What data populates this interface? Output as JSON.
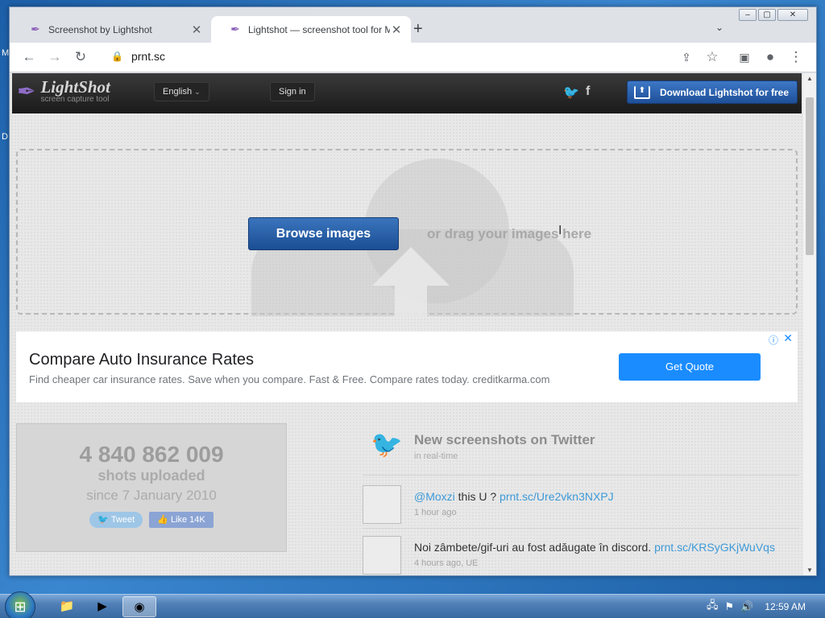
{
  "browser": {
    "tabs": [
      {
        "label": "Screenshot by Lightshot",
        "active": false
      },
      {
        "label": "Lightshot — screenshot tool for M",
        "active": true
      }
    ],
    "url": "prnt.sc"
  },
  "site": {
    "logo_title": "LightShot",
    "logo_subtitle": "screen capture tool",
    "language": "English",
    "language_caret": "⌄",
    "signin": "Sign in",
    "twitter_glyph": "🐦",
    "facebook_glyph": "f",
    "download": "Download Lightshot for free"
  },
  "upload": {
    "browse": "Browse images",
    "drag": "or drag your images here"
  },
  "ad": {
    "title": "Compare Auto Insurance Rates",
    "description": "Find cheaper car insurance rates. Save when you compare. Fast & Free. Compare rates today. creditkarma.com",
    "cta": "Get Quote"
  },
  "stats": {
    "count": "4 840 862 009",
    "label": "shots uploaded",
    "since": "since 7 January 2010",
    "tweet_btn": "Tweet",
    "like_btn": "Like 14K"
  },
  "feed": {
    "title": "New screenshots on Twitter",
    "subtitle": "in real-time",
    "tweets": [
      {
        "user": "@Moxzi",
        "text": " this U ? ",
        "link": "prnt.sc/Ure2vkn3NXPJ",
        "time": "1 hour ago"
      },
      {
        "user": "",
        "text": "Noi zâmbete/gif-uri au fost adăugate în discord. ",
        "link": "prnt.sc/KRSyGKjWuVqs",
        "time": "4 hours ago, UE"
      }
    ]
  },
  "taskbar": {
    "time": "12:59 AM"
  },
  "colors": {
    "accent": "#1a8cff",
    "brand_blue": "#1e4f98",
    "twitter": "#3aa0e8"
  },
  "icons": [
    "back-icon",
    "forward-icon",
    "reload-icon",
    "lock-icon",
    "share-icon",
    "star-icon",
    "sidepanel-icon",
    "profile-icon",
    "menu-icon",
    "feather-icon",
    "twitter-icon",
    "facebook-icon",
    "download-icon",
    "cloud-upload-icon",
    "adinfo-icon",
    "close-icon"
  ]
}
